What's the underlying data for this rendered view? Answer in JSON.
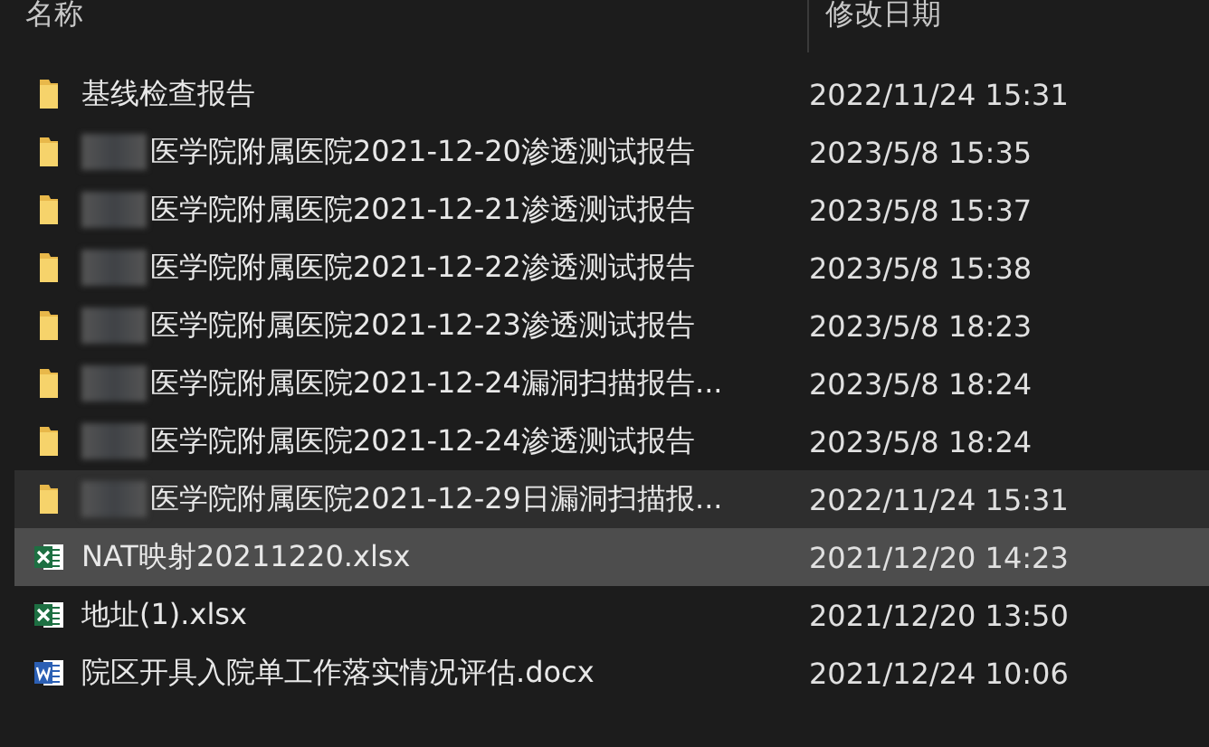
{
  "columns": [
    {
      "label": "名称"
    },
    {
      "label": "修改日期"
    }
  ],
  "files": [
    {
      "kind": "folder",
      "redacted": false,
      "name": "基线检查报告",
      "modified": "2022/11/24 15:31",
      "selected": false,
      "hovered": false
    },
    {
      "kind": "folder",
      "redacted": true,
      "name": "医学院附属医院2021-12-20渗透测试报告",
      "modified": "2023/5/8 15:35",
      "selected": false,
      "hovered": false
    },
    {
      "kind": "folder",
      "redacted": true,
      "name": "医学院附属医院2021-12-21渗透测试报告",
      "modified": "2023/5/8 15:37",
      "selected": false,
      "hovered": false
    },
    {
      "kind": "folder",
      "redacted": true,
      "name": "医学院附属医院2021-12-22渗透测试报告",
      "modified": "2023/5/8 15:38",
      "selected": false,
      "hovered": false
    },
    {
      "kind": "folder",
      "redacted": true,
      "name": "医学院附属医院2021-12-23渗透测试报告",
      "modified": "2023/5/8 18:23",
      "selected": false,
      "hovered": false
    },
    {
      "kind": "folder",
      "redacted": true,
      "name": "医学院附属医院2021-12-24漏洞扫描报告...",
      "modified": "2023/5/8 18:24",
      "selected": false,
      "hovered": false
    },
    {
      "kind": "folder",
      "redacted": true,
      "name": "医学院附属医院2021-12-24渗透测试报告",
      "modified": "2023/5/8 18:24",
      "selected": false,
      "hovered": false
    },
    {
      "kind": "folder",
      "redacted": true,
      "name": "医学院附属医院2021-12-29日漏洞扫描报...",
      "modified": "2022/11/24 15:31",
      "selected": false,
      "hovered": true
    },
    {
      "kind": "excel",
      "redacted": false,
      "name": "NAT映射20211220.xlsx",
      "modified": "2021/12/20 14:23",
      "selected": true,
      "hovered": false
    },
    {
      "kind": "excel",
      "redacted": false,
      "name": "地址(1).xlsx",
      "modified": "2021/12/20 13:50",
      "selected": false,
      "hovered": false
    },
    {
      "kind": "word",
      "redacted": false,
      "name": "院区开具入院单工作落实情况评估.docx",
      "modified": "2021/12/24 10:06",
      "selected": false,
      "hovered": false
    }
  ]
}
